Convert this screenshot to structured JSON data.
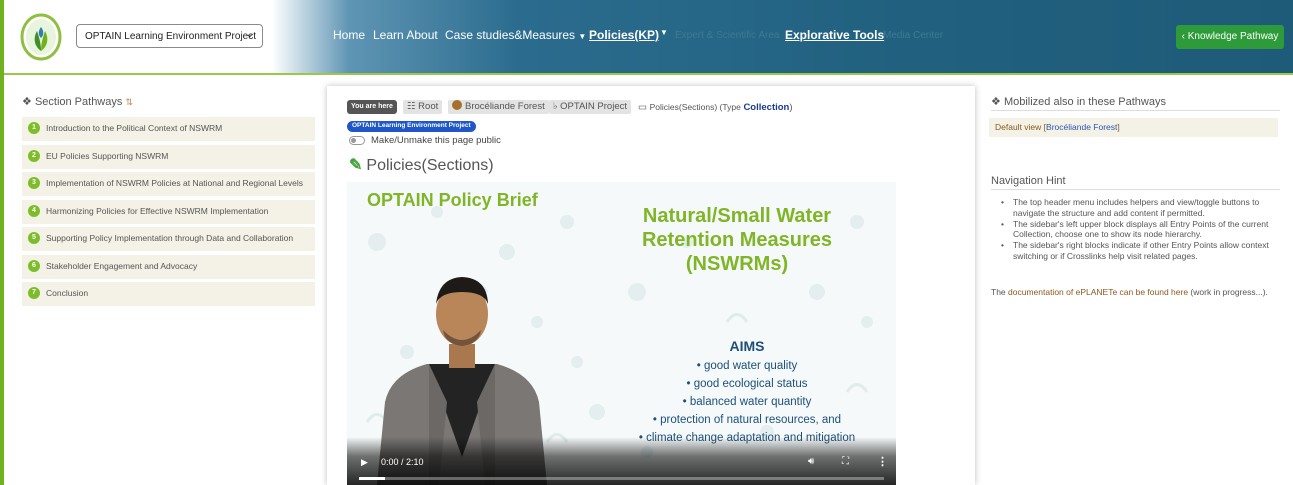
{
  "header": {
    "project_select_value": "OPTAIN Learning Environment Project",
    "nav": {
      "home": "Home",
      "learn_about": "Learn About",
      "case_studies": "Case studies&Measures",
      "policies": "Policies(KP)",
      "expert_area": "Expert & Scientific Area",
      "explorative_tools": "Explorative Tools",
      "media_center": "Media Center"
    },
    "kp_button": "Knowledge Pathway"
  },
  "sidebar": {
    "title": "Section Pathways",
    "items": [
      {
        "num": "1",
        "label": "Introduction to the Political Context of NSWRM"
      },
      {
        "num": "2",
        "label": "EU Policies Supporting NSWRM"
      },
      {
        "num": "3",
        "label": "Implementation of NSWRM Policies at National and Regional Levels"
      },
      {
        "num": "4",
        "label": "Harmonizing Policies for Effective NSWRM Implementation"
      },
      {
        "num": "5",
        "label": "Supporting Policy Implementation through Data and Collaboration"
      },
      {
        "num": "6",
        "label": "Stakeholder Engagement and Advocacy"
      },
      {
        "num": "7",
        "label": "Conclusion"
      }
    ]
  },
  "main": {
    "breadcrumb": {
      "you_are_here": "You are here",
      "root": "Root",
      "forest": "Brocéliande Forest",
      "project": "OPTAIN Project",
      "policies_prefix": "Policies(Sections) (Type",
      "type_value": "Collection",
      "close_paren": ")"
    },
    "project_badge": "OPTAIN Learning Environment Project",
    "toggle_label": "Make/Unmake this page public",
    "page_title": "Policies(Sections)",
    "video": {
      "brief": "OPTAIN Policy Brief",
      "title_line1": "Natural/Small Water",
      "title_line2": "Retention Measures",
      "title_line3": "(NSWRMs)",
      "aims_heading": "AIMS",
      "aims": [
        "good water quality",
        "good ecological status",
        "balanced water quantity",
        "protection of natural resources, and",
        "climate change adaptation and mitigation"
      ],
      "time": "0:00 / 2:10",
      "progress_fraction": 0.05
    }
  },
  "right": {
    "mobilized_title": "Mobilized also in these Pathways",
    "default_view": "Default view [",
    "default_view_link": "Brocéliande Forest",
    "default_view_close": "]",
    "hint_title": "Navigation Hint",
    "hints": [
      "The top header menu includes helpers and view/toggle buttons to navigate the structure and add content if permitted.",
      "The sidebar's left upper block displays all Entry Points of the current Collection, choose one to show its node hierarchy.",
      "The sidebar's right blocks indicate if other Entry Points allow context switching or if Crosslinks help visit related pages."
    ],
    "doc_prefix": "The ",
    "doc_link": "documentation of ePLANETe can be found here",
    "doc_suffix": " (work in progress...)."
  },
  "colors": {
    "brand_green": "#7dbd2a",
    "header_blue": "#21607f",
    "kp_button": "#2e9b3a"
  }
}
